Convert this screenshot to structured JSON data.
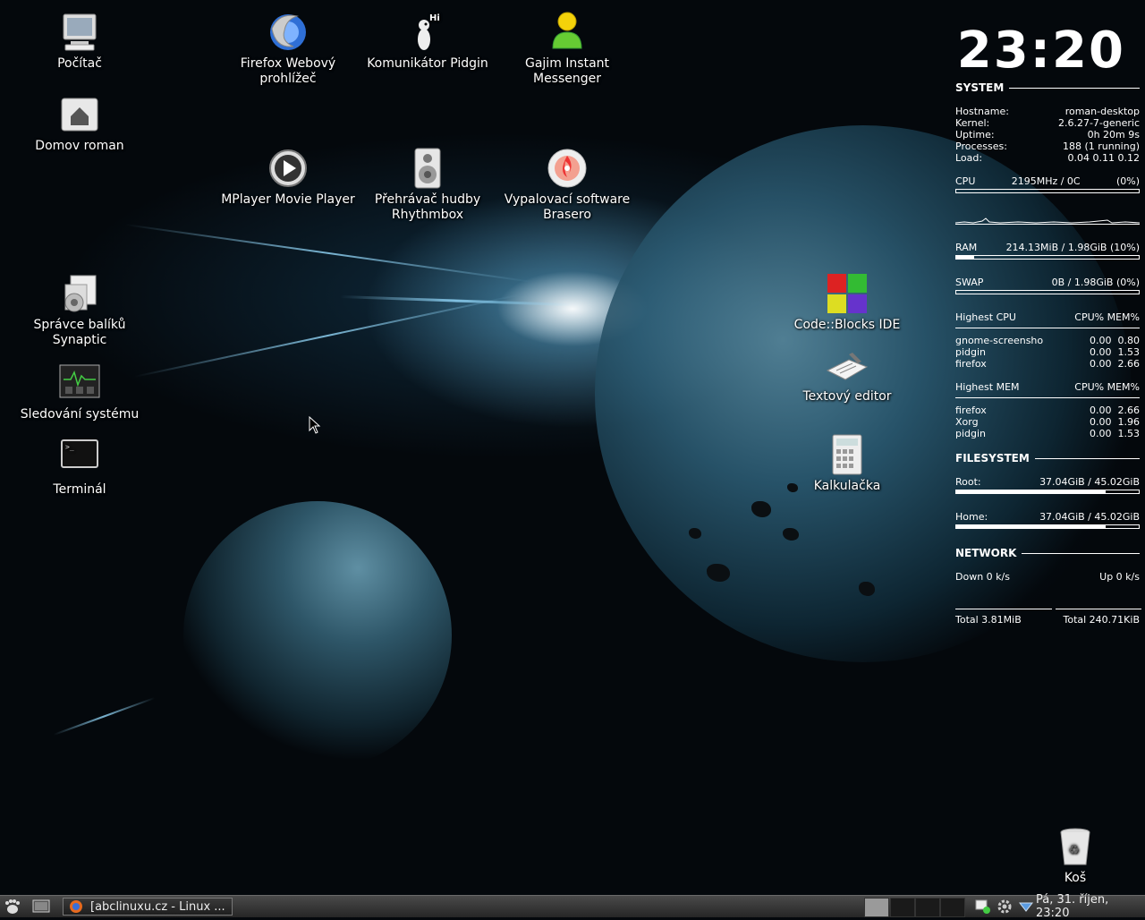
{
  "desktop": {
    "icons": [
      {
        "label": "Počítač",
        "icon": "computer-icon"
      },
      {
        "label": "Domov roman",
        "icon": "home-folder-icon"
      },
      {
        "label": "Správce balíků Synaptic",
        "icon": "synaptic-icon"
      },
      {
        "label": "Sledování systému",
        "icon": "system-monitor-icon"
      },
      {
        "label": "Terminál",
        "icon": "terminal-icon"
      },
      {
        "label": "Firefox Webový prohlížeč",
        "icon": "firefox-icon"
      },
      {
        "label": "Komunikátor Pidgin",
        "icon": "pidgin-icon"
      },
      {
        "label": "Gajim Instant Messenger",
        "icon": "gajim-icon"
      },
      {
        "label": "MPlayer Movie Player",
        "icon": "mplayer-icon"
      },
      {
        "label": "Přehrávač hudby Rhythmbox",
        "icon": "rhythmbox-icon"
      },
      {
        "label": "Vypalovací software Brasero",
        "icon": "brasero-icon"
      },
      {
        "label": "Code::Blocks IDE",
        "icon": "codeblocks-icon"
      },
      {
        "label": "Textový editor",
        "icon": "text-editor-icon"
      },
      {
        "label": "Kalkulačka",
        "icon": "calculator-icon"
      },
      {
        "label": "Koš",
        "icon": "trash-icon"
      }
    ],
    "pidgin_badge": "Hi"
  },
  "conky": {
    "clock": "23:20",
    "system": {
      "title": "SYSTEM",
      "rows": [
        {
          "k": "Hostname:",
          "v": "roman-desktop"
        },
        {
          "k": "Kernel:",
          "v": "2.6.27-7-generic"
        },
        {
          "k": "Uptime:",
          "v": "0h 20m 9s"
        },
        {
          "k": "Processes:",
          "v": "188 (1 running)"
        },
        {
          "k": "Load:",
          "v": "0.04 0.11 0.12"
        }
      ],
      "cpu": {
        "label": "CPU",
        "freq": "2195MHz / 0C",
        "pct": "(0%)",
        "usage": 0
      },
      "ram": {
        "label": "RAM",
        "value": "214.13MiB / 1.98GiB (10%)",
        "usage": 0.1
      },
      "swap": {
        "label": "SWAP",
        "value": "0B / 1.98GiB (0%)",
        "usage": 0
      }
    },
    "highest_cpu": {
      "title": "Highest CPU",
      "cols": "CPU% MEM%",
      "rows": [
        {
          "name": "gnome-screensho",
          "vals": "0.00  0.80"
        },
        {
          "name": "pidgin",
          "vals": "0.00  1.53"
        },
        {
          "name": "firefox",
          "vals": "0.00  2.66"
        }
      ]
    },
    "highest_mem": {
      "title": "Highest MEM",
      "cols": "CPU% MEM%",
      "rows": [
        {
          "name": "firefox",
          "vals": "0.00  2.66"
        },
        {
          "name": "Xorg",
          "vals": "0.00  1.96"
        },
        {
          "name": "pidgin",
          "vals": "0.00  1.53"
        }
      ]
    },
    "filesystem": {
      "title": "FILESYSTEM",
      "root": {
        "label": "Root:",
        "value": "37.04GiB / 45.02GiB",
        "usage": 0.82
      },
      "home": {
        "label": "Home:",
        "value": "37.04GiB / 45.02GiB",
        "usage": 0.82
      }
    },
    "network": {
      "title": "NETWORK",
      "down": "Down 0 k/s",
      "up": "Up 0 k/s",
      "total_down": "Total 3.81MiB",
      "total_up": "Total 240.71KiB"
    }
  },
  "taskbar": {
    "task_label": "[abclinuxu.cz - Linux ...",
    "datetime": "Pá, 31. říjen, 23:20"
  }
}
